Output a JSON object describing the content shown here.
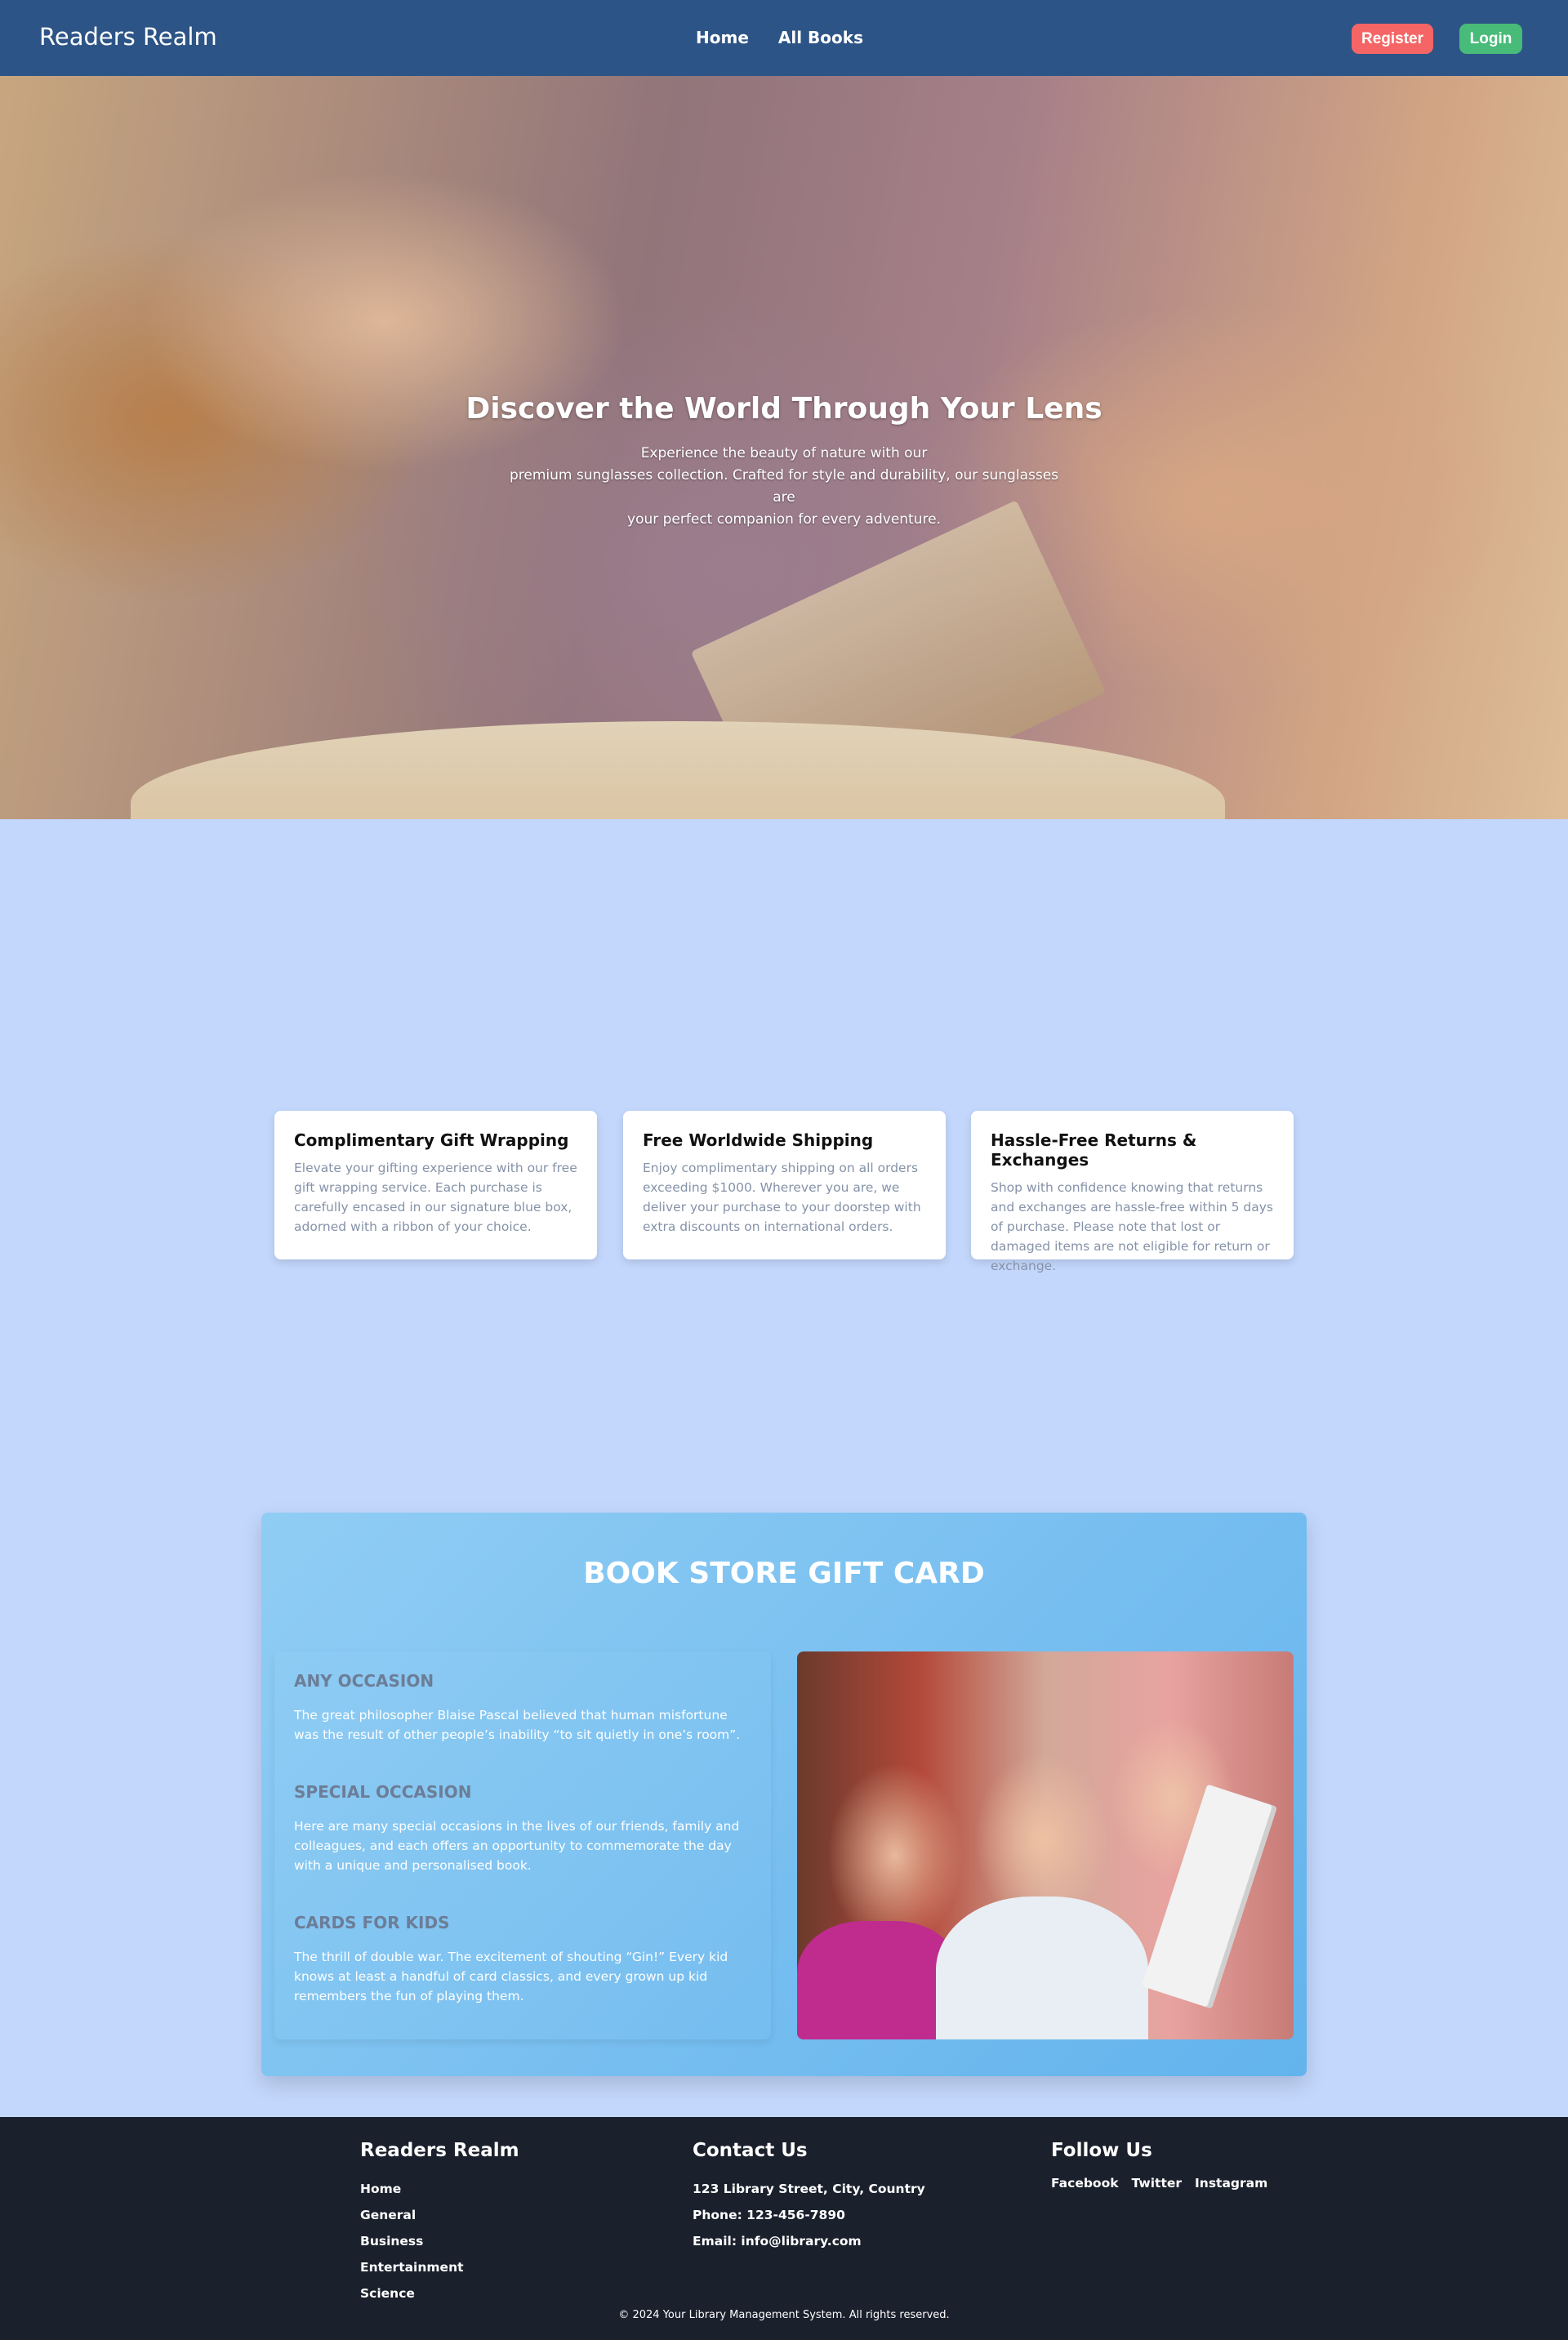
{
  "nav": {
    "brand": "Readers Realm",
    "links": [
      "Home",
      "All Books"
    ],
    "register_label": "Register",
    "login_label": "Login"
  },
  "hero": {
    "title": "Discover the World Through Your Lens",
    "subtitle_lines": [
      "Experience the beauty of nature with our",
      "premium sunglasses collection. Crafted for style and durability, our sunglasses are",
      "your perfect companion for every adventure."
    ]
  },
  "features": [
    {
      "title": "Complimentary Gift Wrapping",
      "text": "Elevate your gifting experience with our free gift wrapping service. Each purchase is carefully encased in our signature blue box, adorned with a ribbon of your choice."
    },
    {
      "title": "Free Worldwide Shipping",
      "text": "Enjoy complimentary shipping on all orders exceeding $1000. Wherever you are, we deliver your purchase to your doorstep with extra discounts on international orders."
    },
    {
      "title": "Hassle-Free Returns & Exchanges",
      "text": "Shop with confidence knowing that returns and exchanges are hassle-free within 5 days of purchase. Please note that lost or damaged items are not eligible for return or exchange."
    }
  ],
  "gift_card": {
    "title": "BOOK STORE GIFT CARD",
    "occasions": [
      {
        "heading": "ANY OCCASION",
        "text": "The great philosopher Blaise Pascal believed that human misfortune was the result of other people’s inability “to sit quietly in one’s room”."
      },
      {
        "heading": "SPECIAL OCCASION",
        "text": "Here are many special occasions in the lives of our friends, family and colleagues, and each offers an opportunity to commemorate the day with a unique and personalised book."
      },
      {
        "heading": "CARDS FOR KIDS",
        "text": "The thrill of double war. The excitement of shouting “Gin!” Every kid knows at least a handful of card classics, and every grown up kid remembers the fun of playing them."
      }
    ]
  },
  "footer": {
    "brand": "Readers Realm",
    "links": [
      "Home",
      "General",
      "Business",
      "Entertainment",
      "Science"
    ],
    "contact_title": "Contact Us",
    "address": "123 Library Street, City, Country",
    "phone": "Phone: 123-456-7890",
    "email": "Email: info@library.com",
    "follow_title": "Follow Us",
    "social": [
      "Facebook",
      "Twitter",
      "Instagram"
    ],
    "copyright": "© 2024 Your Library Management System. All rights reserved."
  },
  "colors": {
    "nav_bg": "#2d5486",
    "page_bg": "#c3d7fc",
    "register": "#f56565",
    "login": "#48bb78",
    "footer_bg": "#1a202c"
  }
}
